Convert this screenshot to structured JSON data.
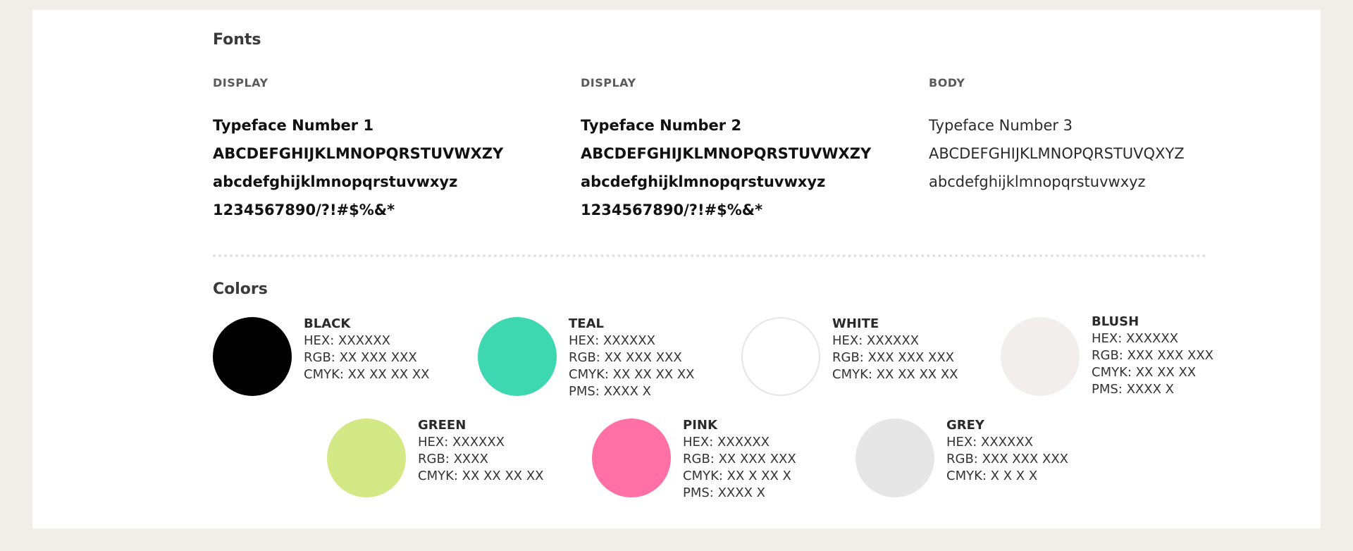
{
  "fonts": {
    "title": "Fonts",
    "columns": [
      {
        "label": "DISPLAY",
        "lines": [
          "Typeface Number 1",
          "ABCDEFGHIJKLMNOPQRSTUVWXZY",
          "abcdefghijklmnopqrstuvwxyz",
          "1234567890/?!#$%&*"
        ]
      },
      {
        "label": "DISPLAY",
        "lines": [
          "Typeface Number 2",
          "ABCDEFGHIJKLMNOPQRSTUVWXZY",
          "abcdefghijklmnopqrstuvwxyz",
          "1234567890/?!#$%&*"
        ]
      },
      {
        "label": "BODY",
        "lines": [
          "Typeface Number 3",
          "ABCDEFGHIJKLMNOPQRSTUVQXYZ",
          "abcdefghijklmnopqrstuvwxyz"
        ]
      }
    ]
  },
  "colors": {
    "title": "Colors",
    "items": [
      {
        "name": "BLACK",
        "swatch": "#000000",
        "hex": "HEX: XXXXXX",
        "rgb": "RGB: XX XXX XXX",
        "cmyk": "CMYK: XX XX XX XX"
      },
      {
        "name": "TEAL",
        "swatch": "#3dd8b0",
        "hex": "HEX: XXXXXX",
        "rgb": "RGB: XX XXX XXX",
        "cmyk": "CMYK: XX XX XX XX",
        "pms": "PMS:  XXXX X"
      },
      {
        "name": "WHITE",
        "swatch": "#ffffff",
        "hex": "HEX: XXXXXX",
        "rgb": "RGB: XXX XXX XXX",
        "cmyk": "CMYK: XX XX XX XX"
      },
      {
        "name": "BLUSH",
        "swatch": "#f2eeee",
        "hex": "HEX: XXXXXX",
        "rgb": "RGB: XXX XXX XXX",
        "cmyk": "CMYK: XX XX XX",
        "pms": "PMS: XXXX X"
      },
      {
        "name": "GREEN",
        "swatch": "#d5e886",
        "hex": "HEX: XXXXXX",
        "rgb": "RGB: XXXX",
        "cmyk": "CMYK: XX XX XX XX"
      },
      {
        "name": "PINK",
        "swatch": "#ff71a5",
        "hex": "HEX: XXXXXX",
        "rgb": "RGB: XX XXX XXX",
        "cmyk": "CMYK: XX X XX X",
        "pms": "PMS:  XXXX X"
      },
      {
        "name": "GREY",
        "swatch": "#e6e6e6",
        "hex": "HEX: XXXXXX",
        "rgb": "RGB: XXX XXX XXX",
        "cmyk": "CMYK: X X X X"
      }
    ]
  }
}
